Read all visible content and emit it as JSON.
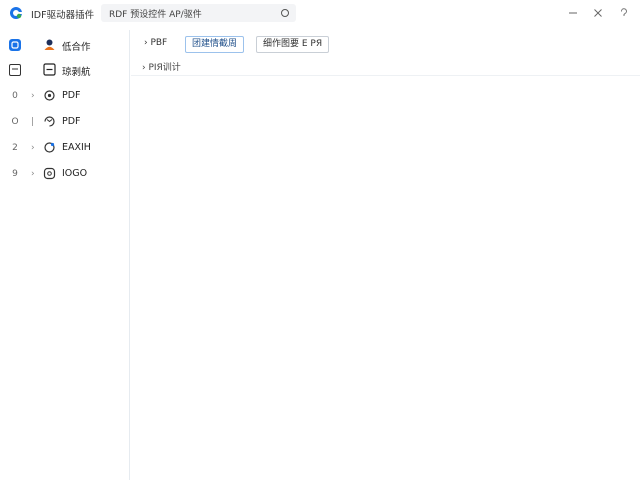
{
  "window": {
    "app_title": "IDF驱动器插件",
    "title_separator": "‹",
    "search": {
      "text": "RDF  预设控件 AP/驱件"
    },
    "controls": {
      "minimize": "minimize-icon",
      "close": "close-icon",
      "help": "help-icon"
    }
  },
  "sidebar": {
    "items": [
      {
        "lead": "",
        "lead_icon": "blue-square-icon",
        "dot": "",
        "icon": "person-icon",
        "label": "低合作"
      },
      {
        "lead": "",
        "lead_icon": "square-icon",
        "dot": "",
        "icon": "minus-box-icon",
        "label": "琼剥航"
      },
      {
        "lead": "0",
        "lead_icon": "",
        "dot": "›",
        "icon": "gear-icon",
        "label": "PDF"
      },
      {
        "lead": "O",
        "lead_icon": "",
        "dot": "|",
        "icon": "refresh-icon",
        "label": "PDF"
      },
      {
        "lead": "2",
        "lead_icon": "",
        "dot": "›",
        "icon": "chat-icon",
        "label": "EAXIH"
      },
      {
        "lead": "9",
        "lead_icon": "",
        "dot": "›",
        "icon": "box-icon",
        "label": "IOGO"
      }
    ]
  },
  "toolbar": {
    "item1": "› PBF",
    "item2": "团建情截周",
    "item3": "细作图要 E PЯ"
  },
  "subheader": {
    "text": "› PIЯ训计"
  },
  "colors": {
    "accent": "#1a73e8",
    "active_border": "#9cc2ec",
    "divider": "#e6ebf0"
  }
}
